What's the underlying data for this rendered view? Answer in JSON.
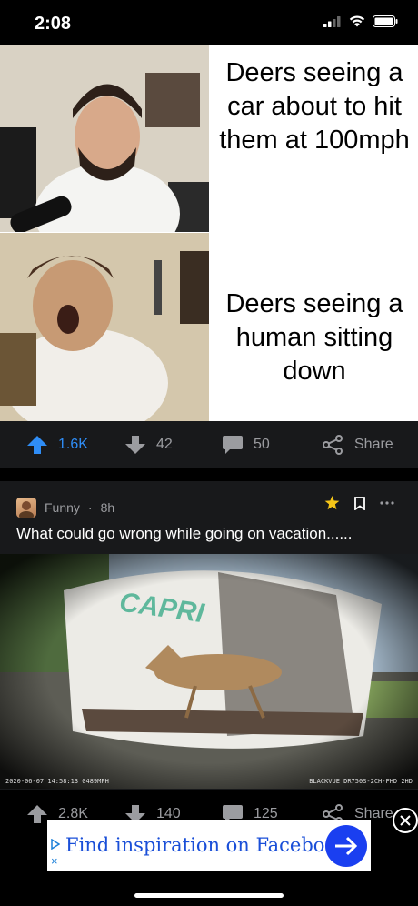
{
  "status_bar": {
    "time": "2:08"
  },
  "post1": {
    "meme_top_caption": "Deers seeing a car about to hit them at 100mph",
    "meme_bottom_caption": "Deers seeing a human sitting down",
    "upvotes": "1.6K",
    "downvotes": "42",
    "comments": "50",
    "share_label": "Share",
    "upvote_color": "#2f8df6"
  },
  "post2": {
    "community": "Funny",
    "age": "8h",
    "title": "What could go wrong while going on vacation......",
    "video_brand_text": "CAPRI",
    "video_timestamp": "2020-06-07 14:58:13 0489MPH",
    "video_cam_id": "BLACKVUE DR750S-2CH-FHD 2HD",
    "upvotes": "2.8K",
    "downvotes": "140",
    "comments": "125",
    "share_label": "Share"
  },
  "ad": {
    "text": "Find inspiration on Faceboo"
  },
  "icons": [
    "signal-icon",
    "wifi-icon",
    "battery-icon",
    "upvote-icon",
    "downvote-icon",
    "comment-icon",
    "share-icon",
    "star-icon",
    "bookmark-icon",
    "more-icon",
    "ad-info-icon",
    "ad-arrow-icon",
    "close-icon"
  ]
}
